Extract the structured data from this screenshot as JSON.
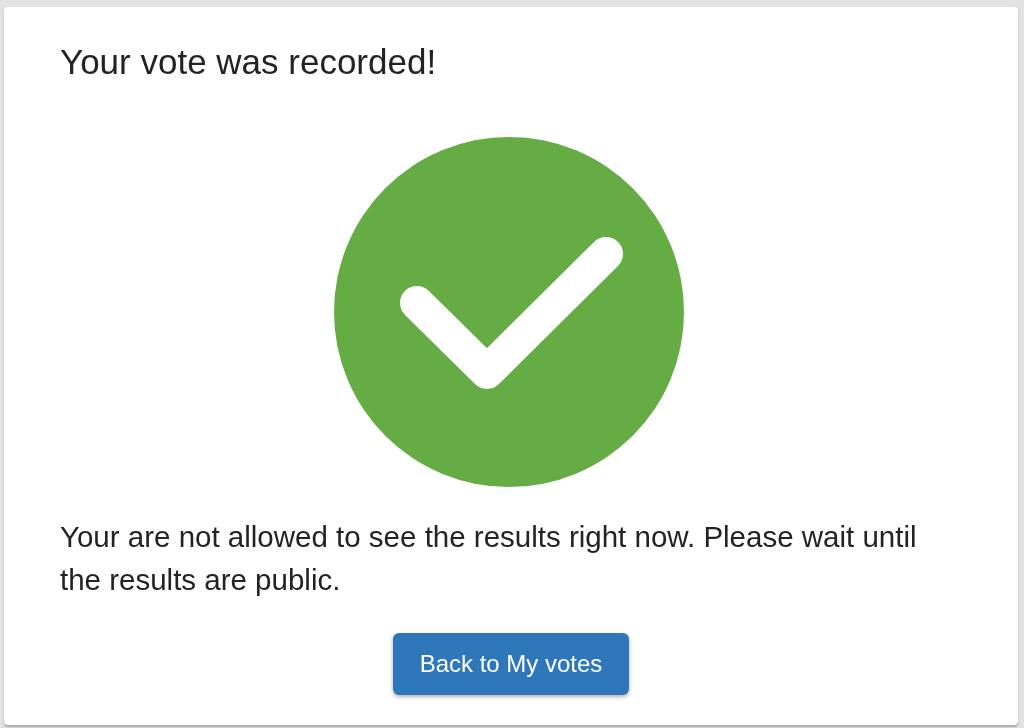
{
  "dialog": {
    "title": "Your vote was recorded!",
    "message": "Your are not allowed to see the results right now. Please wait until the results are public.",
    "buttons": [
      {
        "label": "Back to My votes"
      }
    ]
  }
}
